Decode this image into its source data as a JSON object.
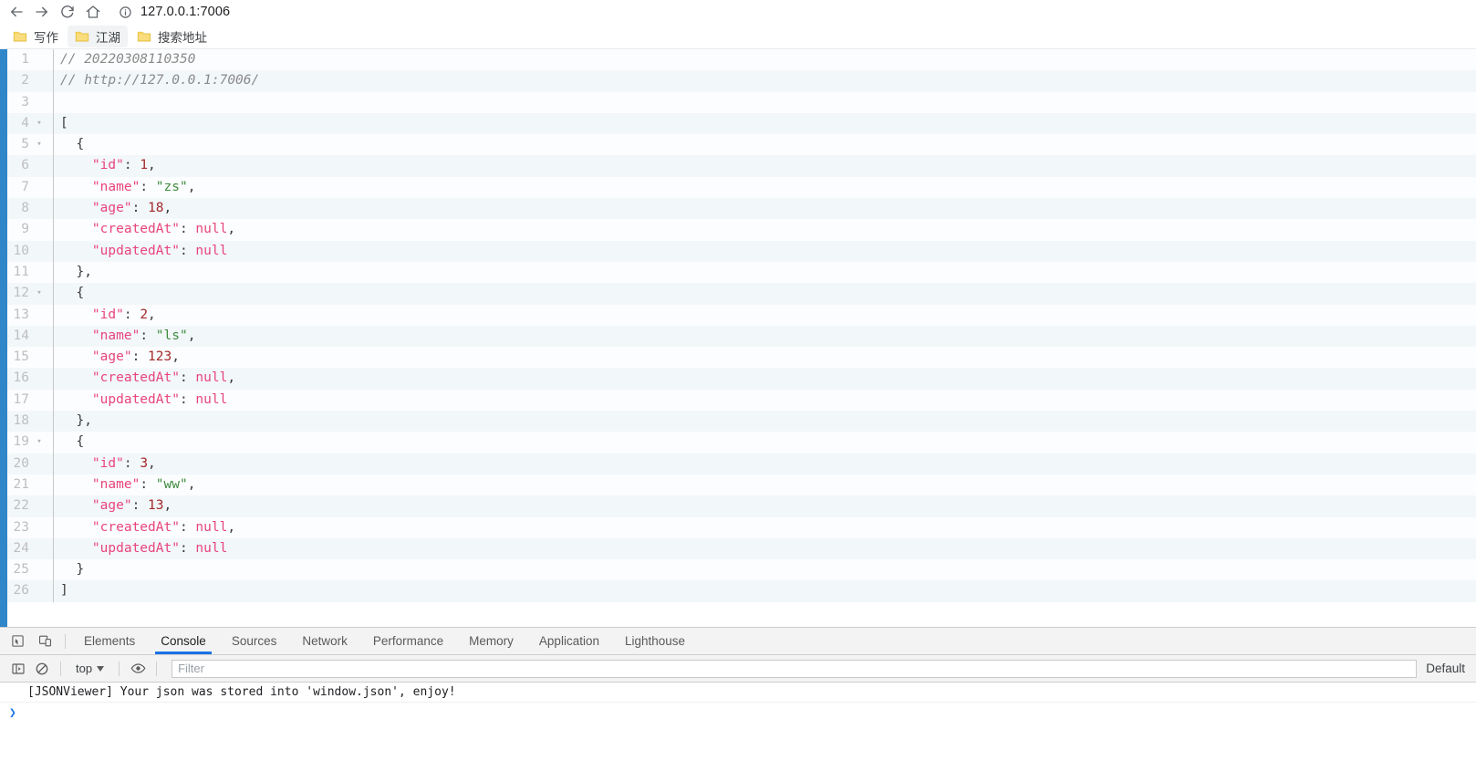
{
  "browser": {
    "nav": {
      "back_label": "Back",
      "forward_label": "Forward",
      "reload_label": "Reload",
      "home_label": "Home",
      "site_info_label": "View site information",
      "url": "127.0.0.1:7006"
    },
    "bookmarks": [
      {
        "label": "写作",
        "icon": "folder-icon",
        "hovered": false
      },
      {
        "label": "江湖",
        "icon": "folder-icon",
        "hovered": true
      },
      {
        "label": "搜索地址",
        "icon": "folder-icon",
        "hovered": false
      }
    ]
  },
  "json_viewer": {
    "lines": [
      {
        "n": "1",
        "fold": "",
        "tokens": [
          {
            "t": "comment",
            "v": "// 20220308110350"
          }
        ]
      },
      {
        "n": "2",
        "fold": "",
        "tokens": [
          {
            "t": "comment",
            "v": "// http://127.0.0.1:7006/"
          }
        ]
      },
      {
        "n": "3",
        "fold": "",
        "tokens": []
      },
      {
        "n": "4",
        "fold": "▾",
        "tokens": [
          {
            "t": "punct",
            "v": "["
          }
        ]
      },
      {
        "n": "5",
        "fold": "▾",
        "tokens": [
          {
            "t": "punct",
            "v": "  {"
          }
        ]
      },
      {
        "n": "6",
        "fold": "",
        "tokens": [
          {
            "t": "key",
            "v": "    \"id\""
          },
          {
            "t": "punct",
            "v": ": "
          },
          {
            "t": "num",
            "v": "1"
          },
          {
            "t": "punct",
            "v": ","
          }
        ]
      },
      {
        "n": "7",
        "fold": "",
        "tokens": [
          {
            "t": "key",
            "v": "    \"name\""
          },
          {
            "t": "punct",
            "v": ": "
          },
          {
            "t": "str",
            "v": "\"zs\""
          },
          {
            "t": "punct",
            "v": ","
          }
        ]
      },
      {
        "n": "8",
        "fold": "",
        "tokens": [
          {
            "t": "key",
            "v": "    \"age\""
          },
          {
            "t": "punct",
            "v": ": "
          },
          {
            "t": "num",
            "v": "18"
          },
          {
            "t": "punct",
            "v": ","
          }
        ]
      },
      {
        "n": "9",
        "fold": "",
        "tokens": [
          {
            "t": "key",
            "v": "    \"createdAt\""
          },
          {
            "t": "punct",
            "v": ": "
          },
          {
            "t": "null",
            "v": "null"
          },
          {
            "t": "punct",
            "v": ","
          }
        ]
      },
      {
        "n": "10",
        "fold": "",
        "tokens": [
          {
            "t": "key",
            "v": "    \"updatedAt\""
          },
          {
            "t": "punct",
            "v": ": "
          },
          {
            "t": "null",
            "v": "null"
          }
        ]
      },
      {
        "n": "11",
        "fold": "",
        "tokens": [
          {
            "t": "punct",
            "v": "  },"
          }
        ]
      },
      {
        "n": "12",
        "fold": "▾",
        "tokens": [
          {
            "t": "punct",
            "v": "  {"
          }
        ]
      },
      {
        "n": "13",
        "fold": "",
        "tokens": [
          {
            "t": "key",
            "v": "    \"id\""
          },
          {
            "t": "punct",
            "v": ": "
          },
          {
            "t": "num",
            "v": "2"
          },
          {
            "t": "punct",
            "v": ","
          }
        ]
      },
      {
        "n": "14",
        "fold": "",
        "tokens": [
          {
            "t": "key",
            "v": "    \"name\""
          },
          {
            "t": "punct",
            "v": ": "
          },
          {
            "t": "str",
            "v": "\"ls\""
          },
          {
            "t": "punct",
            "v": ","
          }
        ]
      },
      {
        "n": "15",
        "fold": "",
        "tokens": [
          {
            "t": "key",
            "v": "    \"age\""
          },
          {
            "t": "punct",
            "v": ": "
          },
          {
            "t": "num",
            "v": "123"
          },
          {
            "t": "punct",
            "v": ","
          }
        ]
      },
      {
        "n": "16",
        "fold": "",
        "tokens": [
          {
            "t": "key",
            "v": "    \"createdAt\""
          },
          {
            "t": "punct",
            "v": ": "
          },
          {
            "t": "null",
            "v": "null"
          },
          {
            "t": "punct",
            "v": ","
          }
        ]
      },
      {
        "n": "17",
        "fold": "",
        "tokens": [
          {
            "t": "key",
            "v": "    \"updatedAt\""
          },
          {
            "t": "punct",
            "v": ": "
          },
          {
            "t": "null",
            "v": "null"
          }
        ]
      },
      {
        "n": "18",
        "fold": "",
        "tokens": [
          {
            "t": "punct",
            "v": "  },"
          }
        ]
      },
      {
        "n": "19",
        "fold": "▾",
        "tokens": [
          {
            "t": "punct",
            "v": "  {"
          }
        ]
      },
      {
        "n": "20",
        "fold": "",
        "tokens": [
          {
            "t": "key",
            "v": "    \"id\""
          },
          {
            "t": "punct",
            "v": ": "
          },
          {
            "t": "num",
            "v": "3"
          },
          {
            "t": "punct",
            "v": ","
          }
        ]
      },
      {
        "n": "21",
        "fold": "",
        "tokens": [
          {
            "t": "key",
            "v": "    \"name\""
          },
          {
            "t": "punct",
            "v": ": "
          },
          {
            "t": "str",
            "v": "\"ww\""
          },
          {
            "t": "punct",
            "v": ","
          }
        ]
      },
      {
        "n": "22",
        "fold": "",
        "tokens": [
          {
            "t": "key",
            "v": "    \"age\""
          },
          {
            "t": "punct",
            "v": ": "
          },
          {
            "t": "num",
            "v": "13"
          },
          {
            "t": "punct",
            "v": ","
          }
        ]
      },
      {
        "n": "23",
        "fold": "",
        "tokens": [
          {
            "t": "key",
            "v": "    \"createdAt\""
          },
          {
            "t": "punct",
            "v": ": "
          },
          {
            "t": "null",
            "v": "null"
          },
          {
            "t": "punct",
            "v": ","
          }
        ]
      },
      {
        "n": "24",
        "fold": "",
        "tokens": [
          {
            "t": "key",
            "v": "    \"updatedAt\""
          },
          {
            "t": "punct",
            "v": ": "
          },
          {
            "t": "null",
            "v": "null"
          }
        ]
      },
      {
        "n": "25",
        "fold": "",
        "tokens": [
          {
            "t": "punct",
            "v": "  }"
          }
        ]
      },
      {
        "n": "26",
        "fold": "",
        "tokens": [
          {
            "t": "punct",
            "v": "]"
          }
        ]
      }
    ]
  },
  "devtools": {
    "inspect_icon": "inspect-element-icon",
    "device_toolbar_icon": "device-toolbar-icon",
    "tabs": [
      {
        "label": "Elements",
        "selected": false
      },
      {
        "label": "Console",
        "selected": true
      },
      {
        "label": "Sources",
        "selected": false
      },
      {
        "label": "Network",
        "selected": false
      },
      {
        "label": "Performance",
        "selected": false
      },
      {
        "label": "Memory",
        "selected": false
      },
      {
        "label": "Application",
        "selected": false
      },
      {
        "label": "Lighthouse",
        "selected": false
      }
    ],
    "console_toolbar": {
      "sidebar_icon": "console-sidebar-icon",
      "clear_icon": "clear-console-icon",
      "context": "top",
      "eye_icon": "live-expression-eye-icon",
      "filter_placeholder": "Filter",
      "filter_value": "",
      "log_level": "Default"
    },
    "console_messages": [
      {
        "text": "[JSONViewer] Your json was stored into 'window.json', enjoy!"
      }
    ],
    "prompt_symbol": "❯"
  },
  "colors": {
    "accent_blue": "#1a73e8",
    "rail_blue": "#2f86c9",
    "key_pink": "#e8457b",
    "string_green": "#3e8b3e",
    "number_maroon": "#a52a2a",
    "comment_gray": "#8a8a8a",
    "folder_yellow": "#f7d365"
  }
}
